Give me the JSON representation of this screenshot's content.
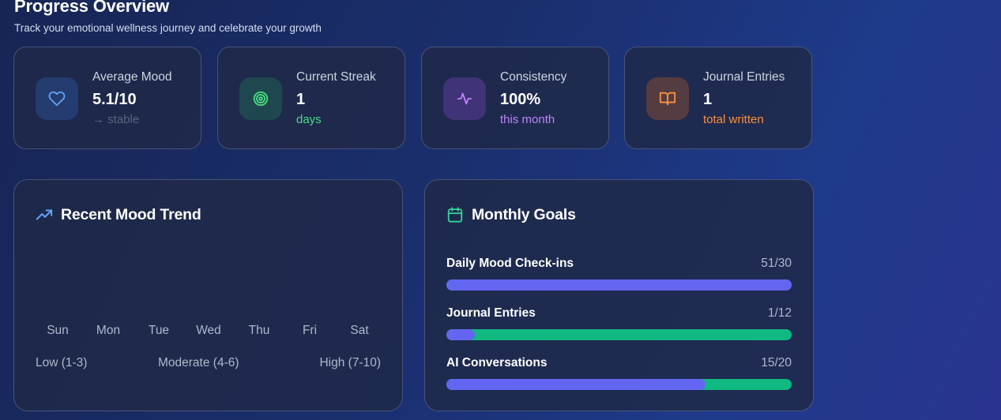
{
  "header": {
    "title": "Progress Overview",
    "subtitle": "Track your emotional wellness journey and celebrate your growth"
  },
  "stats": [
    {
      "label": "Average Mood",
      "value": "5.1/10",
      "sub": "→ stable",
      "icon": "heart-icon",
      "color": "#60a5fa"
    },
    {
      "label": "Current Streak",
      "value": "1",
      "sub": "days",
      "icon": "target-icon",
      "color": "#4ade80"
    },
    {
      "label": "Consistency",
      "value": "100%",
      "sub": "this month",
      "icon": "activity-icon",
      "color": "#c084fc"
    },
    {
      "label": "Journal Entries",
      "value": "1",
      "sub": "total written",
      "icon": "book-open-icon",
      "color": "#fb923c"
    }
  ],
  "mood_trend": {
    "title": "Recent Mood Trend",
    "icon": "trending-up-icon",
    "days": [
      "Sun",
      "Mon",
      "Tue",
      "Wed",
      "Thu",
      "Fri",
      "Sat"
    ],
    "legend": [
      "Low (1-3)",
      "Moderate (4-6)",
      "High (7-10)"
    ]
  },
  "goals": {
    "title": "Monthly Goals",
    "icon": "calendar-icon",
    "items": [
      {
        "label": "Daily Mood Check-ins",
        "count": "51/30",
        "progress": 1.0
      },
      {
        "label": "Journal Entries",
        "count": "1/12",
        "progress": 0.083
      },
      {
        "label": "AI Conversations",
        "count": "15/20",
        "progress": 0.75
      }
    ]
  },
  "colors": {
    "bar_fill": "#6366f1",
    "bar_track": "#10b981"
  }
}
